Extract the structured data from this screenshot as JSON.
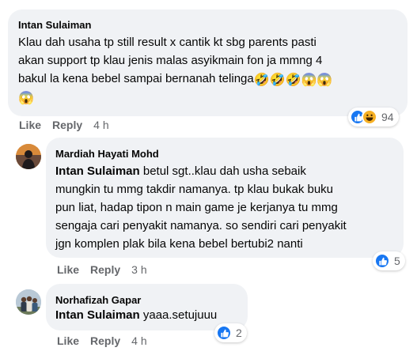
{
  "comments": [
    {
      "author": "Intan Sulaiman",
      "text_lines": [
        "Klau dah usaha tp still result x cantik kt sbg parents pasti",
        "akan support tp klau jenis malas asyikmain fon ja mmng 4",
        "bakul la kena bebel sampai bernanah telinga"
      ],
      "emojis_line3": [
        "🤣",
        "🤣",
        "🤣",
        "😱",
        "😱"
      ],
      "emojis_line4": [
        "😱"
      ],
      "like_label": "Like",
      "reply_label": "Reply",
      "time": "4 h",
      "reaction_count": "94",
      "reaction_icons": [
        "like-icon",
        "haha-icon"
      ]
    },
    {
      "author": "Mardiah Hayati Mohd",
      "mention": "Intan Sulaiman",
      "text_first": "betul sgt..klau dah usha sebaik",
      "text_lines": [
        "mungkin tu mmg takdir namanya. tp klau bukak buku",
        "pun liat, hadap tipon n main game je kerjanya tu mmg",
        "sengaja cari penyakit namanya. so sendiri cari penyakit",
        "jgn komplen plak bila kena bebel bertubi2 nanti"
      ],
      "like_label": "Like",
      "reply_label": "Reply",
      "time": "3 h",
      "reaction_count": "5",
      "reaction_icons": [
        "like-icon"
      ]
    },
    {
      "author": "Norhafizah Gapar",
      "mention": "Intan Sulaiman",
      "text_first": "yaaa.setujuuu",
      "like_label": "Like",
      "reply_label": "Reply",
      "time": "4 h",
      "reaction_count": "2",
      "reaction_icons": [
        "like-icon"
      ]
    }
  ],
  "colors": {
    "bubble": "#f0f2f5",
    "secondary_text": "#65676b",
    "like_blue": "#1877f2",
    "haha_yellow": "#f7b125"
  }
}
